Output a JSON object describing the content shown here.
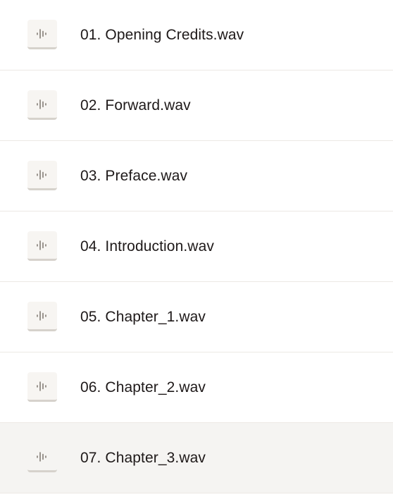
{
  "files": [
    {
      "name": "01. Opening Credits.wav",
      "icon": "audio-file-icon",
      "selected": false
    },
    {
      "name": "02. Forward.wav",
      "icon": "audio-file-icon",
      "selected": false
    },
    {
      "name": "03. Preface.wav",
      "icon": "audio-file-icon",
      "selected": false
    },
    {
      "name": "04. Introduction.wav",
      "icon": "audio-file-icon",
      "selected": false
    },
    {
      "name": "05. Chapter_1.wav",
      "icon": "audio-file-icon",
      "selected": false
    },
    {
      "name": "06. Chapter_2.wav",
      "icon": "audio-file-icon",
      "selected": false
    },
    {
      "name": "07. Chapter_3.wav",
      "icon": "audio-file-icon",
      "selected": true
    }
  ],
  "colors": {
    "text": "#1e1919",
    "divider": "#ece9e4",
    "selected_background": "#f5f4f2",
    "icon_tile": "#f7f5f2",
    "icon_glyph": "#736c64"
  }
}
